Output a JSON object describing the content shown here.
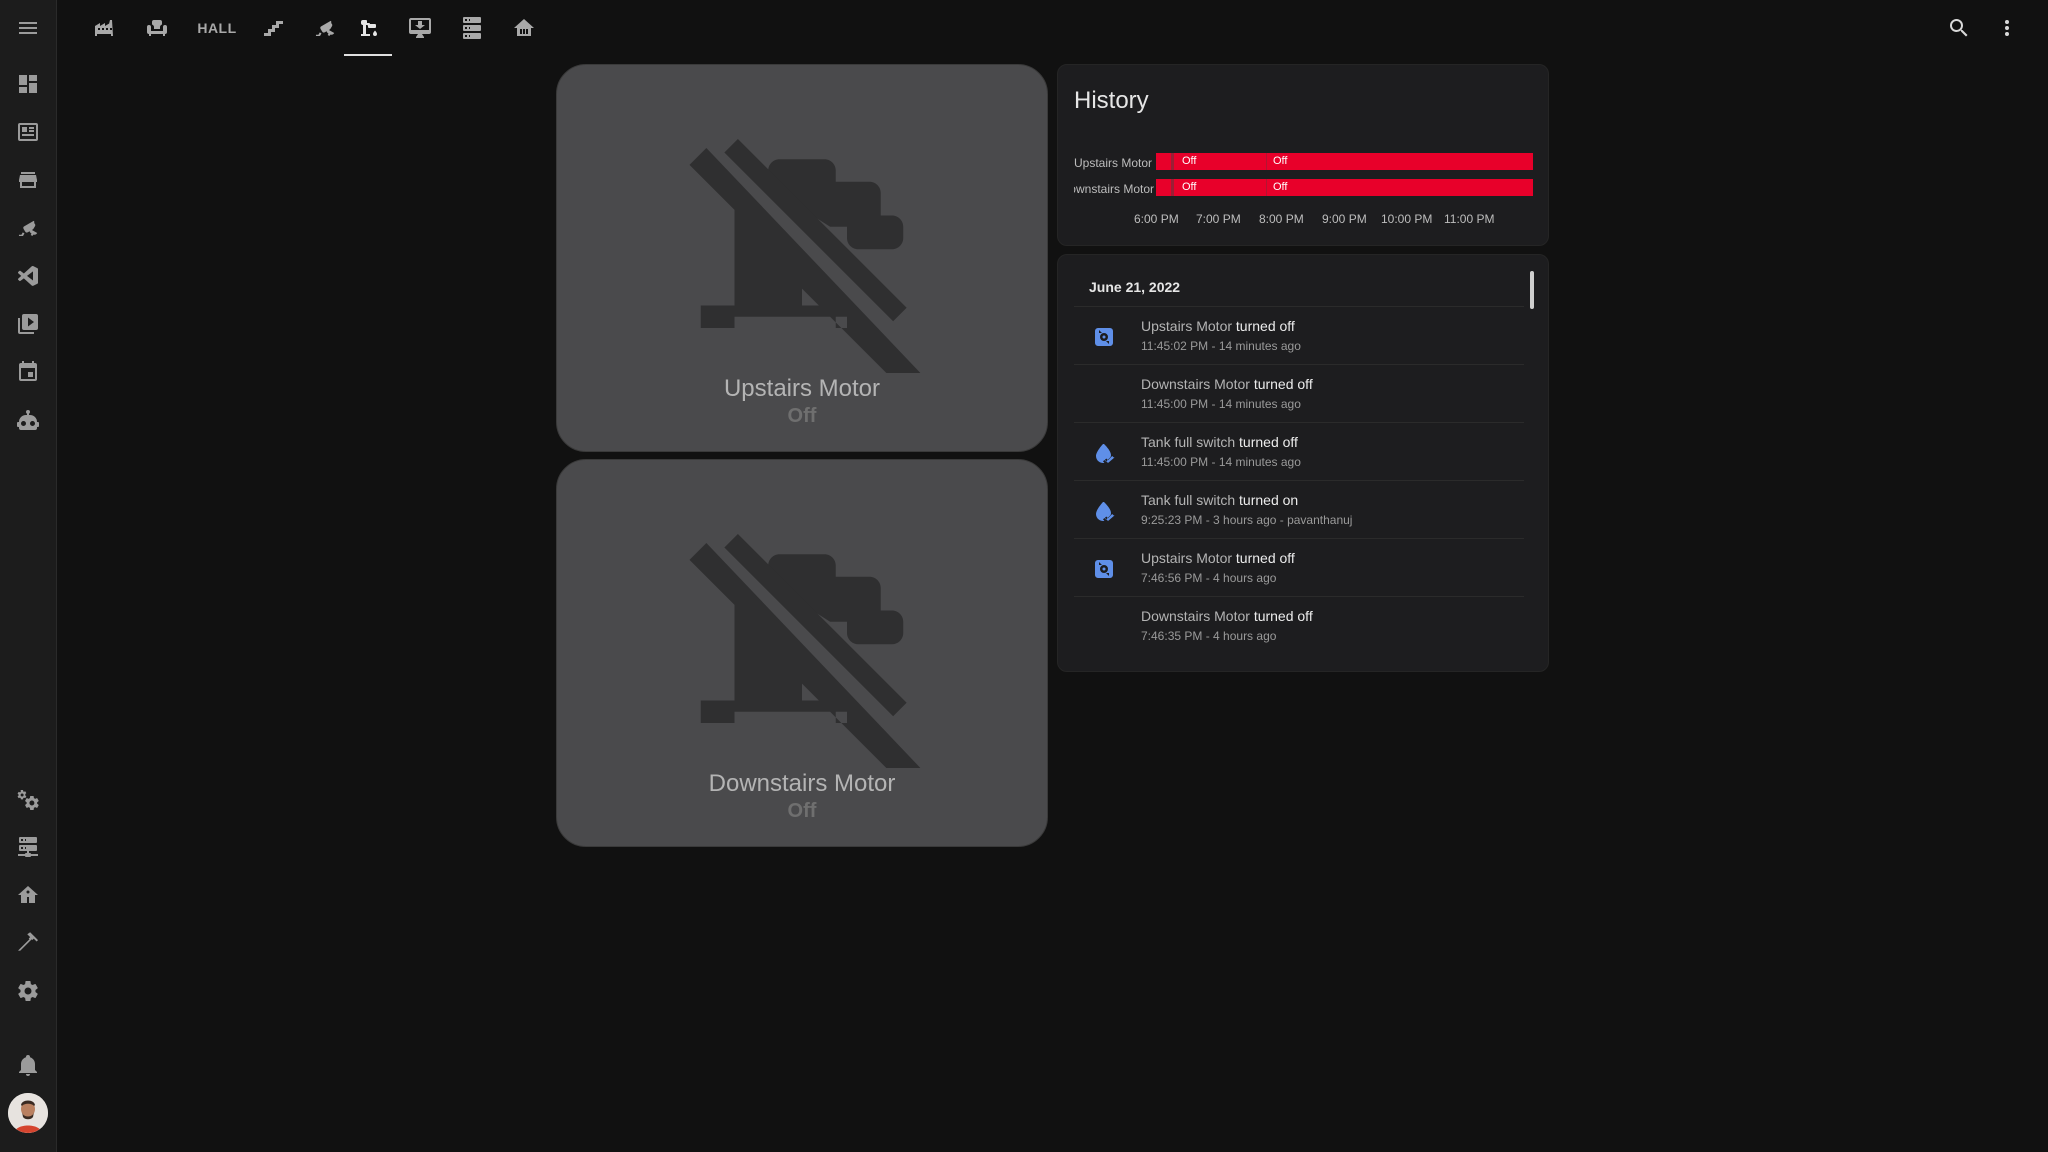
{
  "header": {
    "tabs": [
      {
        "name": "factory",
        "icon": "factory-icon"
      },
      {
        "name": "sofa",
        "icon": "sofa-icon"
      },
      {
        "name": "hall",
        "label": "HALL"
      },
      {
        "name": "stairs",
        "icon": "stairs-icon"
      },
      {
        "name": "cctv",
        "icon": "cctv-icon"
      },
      {
        "name": "water-pump",
        "icon": "water-pump-icon",
        "active": true
      },
      {
        "name": "monitor",
        "icon": "monitor-download-icon"
      },
      {
        "name": "server",
        "icon": "server-icon"
      },
      {
        "name": "home",
        "icon": "home-icon"
      }
    ],
    "actions": [
      "search-icon",
      "more-vertical-icon"
    ]
  },
  "sidebar": {
    "items": [
      "view-dashboard-icon",
      "newspaper-icon",
      "store-icon",
      "cctv-icon",
      "vscode-icon",
      "media-icon",
      "calendar-icon",
      "robot-icon"
    ],
    "bottom_items": [
      "cogs-icon",
      "server-network-icon",
      "home-network-icon",
      "hammer-icon",
      "cog-icon"
    ],
    "notifications": "bell-icon",
    "avatar": "user-avatar"
  },
  "cards": [
    {
      "name": "Upstairs Motor",
      "state": "Off",
      "icon": "water-pump-off-icon"
    },
    {
      "name": "Downstairs Motor",
      "state": "Off",
      "icon": "water-pump-off-icon"
    }
  ],
  "history": {
    "title": "History",
    "rows": [
      {
        "label": "Upstairs Motor",
        "segments": [
          "Off",
          "Off"
        ]
      },
      {
        "label": "Downstairs Motor",
        "segments": [
          "Off",
          "Off"
        ]
      }
    ],
    "ticks": [
      "6:00 PM",
      "7:00 PM",
      "8:00 PM",
      "9:00 PM",
      "10:00 PM",
      "11:00 PM"
    ],
    "bar_color": "#e8002a"
  },
  "logbook": {
    "date": "June 21, 2022",
    "entries": [
      {
        "name": "Upstairs Motor",
        "action": "turned off",
        "time": "11:45:02 PM - 14 minutes ago",
        "icon": "pump-icon"
      },
      {
        "name": "Downstairs Motor",
        "action": "turned off",
        "time": "11:45:00 PM - 14 minutes ago",
        "icon": ""
      },
      {
        "name": "Tank full switch",
        "action": "turned off",
        "time": "11:45:00 PM - 14 minutes ago",
        "icon": "water-check-icon"
      },
      {
        "name": "Tank full switch",
        "action": "turned on",
        "time": "9:25:23 PM - 3 hours ago - pavanthanuj",
        "icon": "water-check-icon"
      },
      {
        "name": "Upstairs Motor",
        "action": "turned off",
        "time": "7:46:56 PM - 4 hours ago",
        "icon": "pump-icon"
      },
      {
        "name": "Downstairs Motor",
        "action": "turned off",
        "time": "7:46:35 PM - 4 hours ago",
        "icon": ""
      }
    ]
  }
}
